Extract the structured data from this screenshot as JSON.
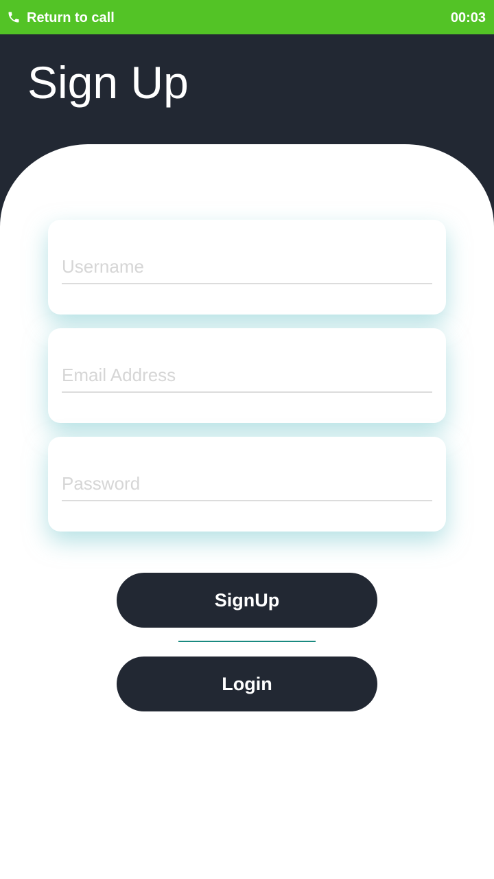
{
  "call_bar": {
    "label": "Return to call",
    "timer": "00:03",
    "icon": "phone-icon",
    "color": "#53c326"
  },
  "header": {
    "title": "Sign Up",
    "color": "#222833"
  },
  "form": {
    "username_placeholder": "Username",
    "email_placeholder": "Email Address",
    "password_placeholder": "Password"
  },
  "buttons": {
    "signup_label": "SignUp",
    "login_label": "Login"
  },
  "colors": {
    "accent_line": "#1a8a80",
    "card_shadow": "#78c8cd"
  }
}
